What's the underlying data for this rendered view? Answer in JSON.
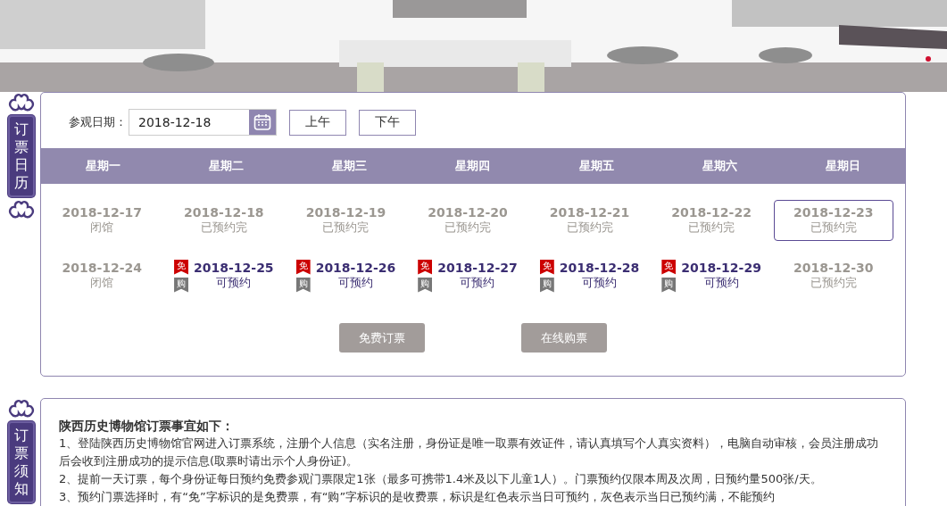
{
  "calendar_panel": {
    "side_label": "订票日历",
    "date_label": "参观日期：",
    "date_value": "2018-12-18",
    "periods": [
      {
        "label": "上午"
      },
      {
        "label": "下午"
      }
    ],
    "weekdays": [
      "星期一",
      "星期二",
      "星期三",
      "星期四",
      "星期五",
      "星期六",
      "星期日"
    ],
    "weeks": [
      [
        {
          "date": "2018-12-17",
          "status": "闭馆",
          "kind": "closed",
          "selected": false
        },
        {
          "date": "2018-12-18",
          "status": "已预约完",
          "kind": "full",
          "selected": false
        },
        {
          "date": "2018-12-19",
          "status": "已预约完",
          "kind": "full",
          "selected": false
        },
        {
          "date": "2018-12-20",
          "status": "已预约完",
          "kind": "full",
          "selected": false
        },
        {
          "date": "2018-12-21",
          "status": "已预约完",
          "kind": "full",
          "selected": false
        },
        {
          "date": "2018-12-22",
          "status": "已预约完",
          "kind": "full",
          "selected": false
        },
        {
          "date": "2018-12-23",
          "status": "已预约完",
          "kind": "full",
          "selected": true
        }
      ],
      [
        {
          "date": "2018-12-24",
          "status": "闭馆",
          "kind": "closed",
          "selected": false
        },
        {
          "date": "2018-12-25",
          "status": "可预约",
          "kind": "available",
          "selected": false,
          "badges": [
            {
              "label": "免",
              "color": "#cc0000"
            },
            {
              "label": "购",
              "color": "#777777"
            }
          ]
        },
        {
          "date": "2018-12-26",
          "status": "可预约",
          "kind": "available",
          "selected": false,
          "badges": [
            {
              "label": "免",
              "color": "#cc0000"
            },
            {
              "label": "购",
              "color": "#777777"
            }
          ]
        },
        {
          "date": "2018-12-27",
          "status": "可预约",
          "kind": "available",
          "selected": false,
          "badges": [
            {
              "label": "免",
              "color": "#cc0000"
            },
            {
              "label": "购",
              "color": "#777777"
            }
          ]
        },
        {
          "date": "2018-12-28",
          "status": "可预约",
          "kind": "available",
          "selected": false,
          "badges": [
            {
              "label": "免",
              "color": "#cc0000"
            },
            {
              "label": "购",
              "color": "#777777"
            }
          ]
        },
        {
          "date": "2018-12-29",
          "status": "可预约",
          "kind": "available",
          "selected": false,
          "badges": [
            {
              "label": "免",
              "color": "#cc0000"
            },
            {
              "label": "购",
              "color": "#777777"
            }
          ]
        },
        {
          "date": "2018-12-30",
          "status": "已预约完",
          "kind": "full",
          "selected": false
        }
      ]
    ],
    "actions": [
      {
        "label": "免费订票"
      },
      {
        "label": "在线购票"
      }
    ]
  },
  "notice_panel": {
    "side_label": "订票须知",
    "title": "陕西历史博物馆订票事宜如下：",
    "paragraphs": [
      "1、登陆陕西历史博物馆官网进入订票系统，注册个人信息（实名注册，身份证是唯一取票有效证件，请认真填写个人真实资料），电脑自动审核，会员注册成功后会收到注册成功的提示信息(取票时请出示个人身份证)。",
      "2、提前一天订票，每个身份证每日预约免费参观门票限定1张（最多可携带1.4米及以下儿童1人）。门票预约仅限本周及次周，日预约量500张/天。",
      "3、预约门票选择时，有“免”字标识的是免费票，有“购”字标识的是收费票，标识是红色表示当日可预约，灰色表示当日已预约满，不能预约"
    ]
  }
}
